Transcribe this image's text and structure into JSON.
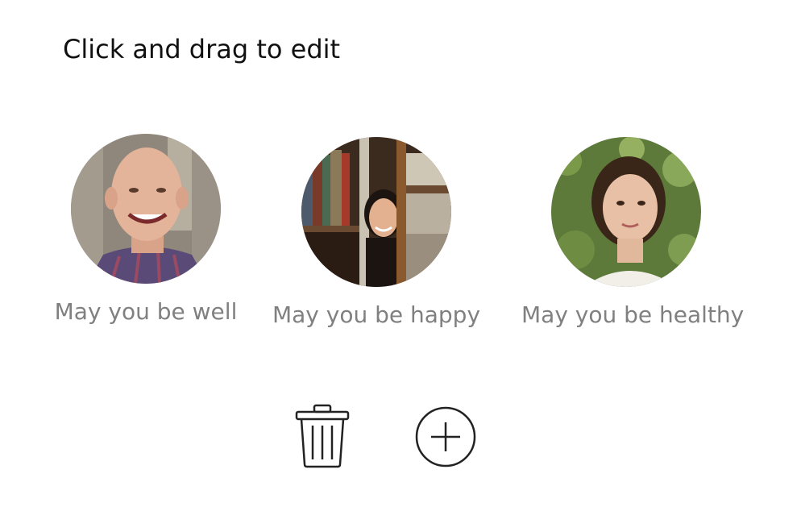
{
  "instruction": "Click and drag to edit",
  "cards": [
    {
      "caption": "May you be well",
      "avatar": "bald-man-photo"
    },
    {
      "caption": "May you be happy",
      "avatar": "woman-bookshelf-photo"
    },
    {
      "caption": "May you be healthy",
      "avatar": "woman-ivy-photo"
    }
  ],
  "actions": {
    "delete_icon": "trash-icon",
    "add_icon": "plus-circle-icon"
  }
}
